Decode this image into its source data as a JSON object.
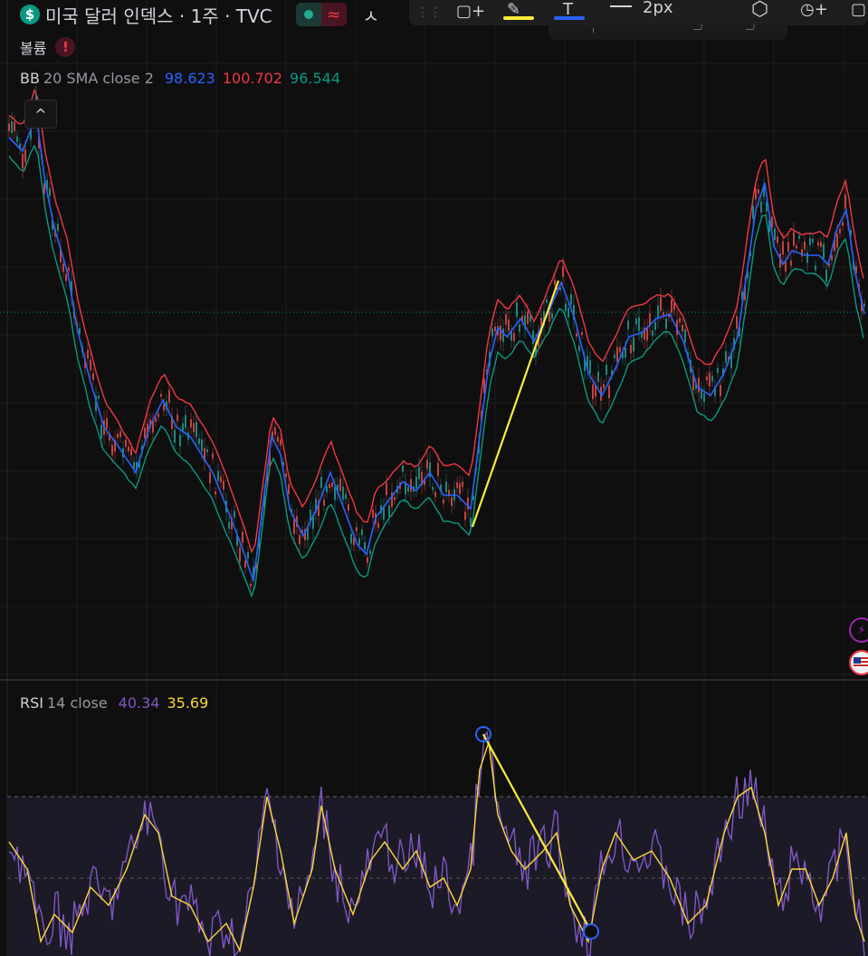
{
  "header": {
    "symbol_title": "미국 달러 인덱스 · 1주 · TVC",
    "currency_glyph": "$",
    "delay_glyph": "≈",
    "truncated_text": "ㅅ"
  },
  "toolbar": {
    "line_width_label": "2px",
    "colors": {
      "highlight": "#ffeb3b",
      "line_color": "#2962ff"
    }
  },
  "volume_panel": {
    "label": "볼륨",
    "warning_glyph": "!"
  },
  "bb_legend": {
    "name": "BB",
    "params": "20 SMA close 2",
    "basis": "98.623",
    "upper": "100.702",
    "lower": "96.544",
    "colors": {
      "basis": "#2962ff",
      "upper": "#f23645",
      "lower": "#089981"
    }
  },
  "rsi_legend": {
    "name": "RSI",
    "params": "14 close",
    "rsi": "40.34",
    "rsi_ma": "35.69",
    "colors": {
      "rsi": "#7e57c2",
      "rsi_ma": "#fdd835"
    }
  },
  "collapse_glyph": "^",
  "side_icons": [
    "lightning-icon",
    "us-flag-icon"
  ],
  "colors": {
    "background": "#0f0f0f",
    "drawing": "#ffeb3b",
    "marker": "#2962ff"
  }
}
